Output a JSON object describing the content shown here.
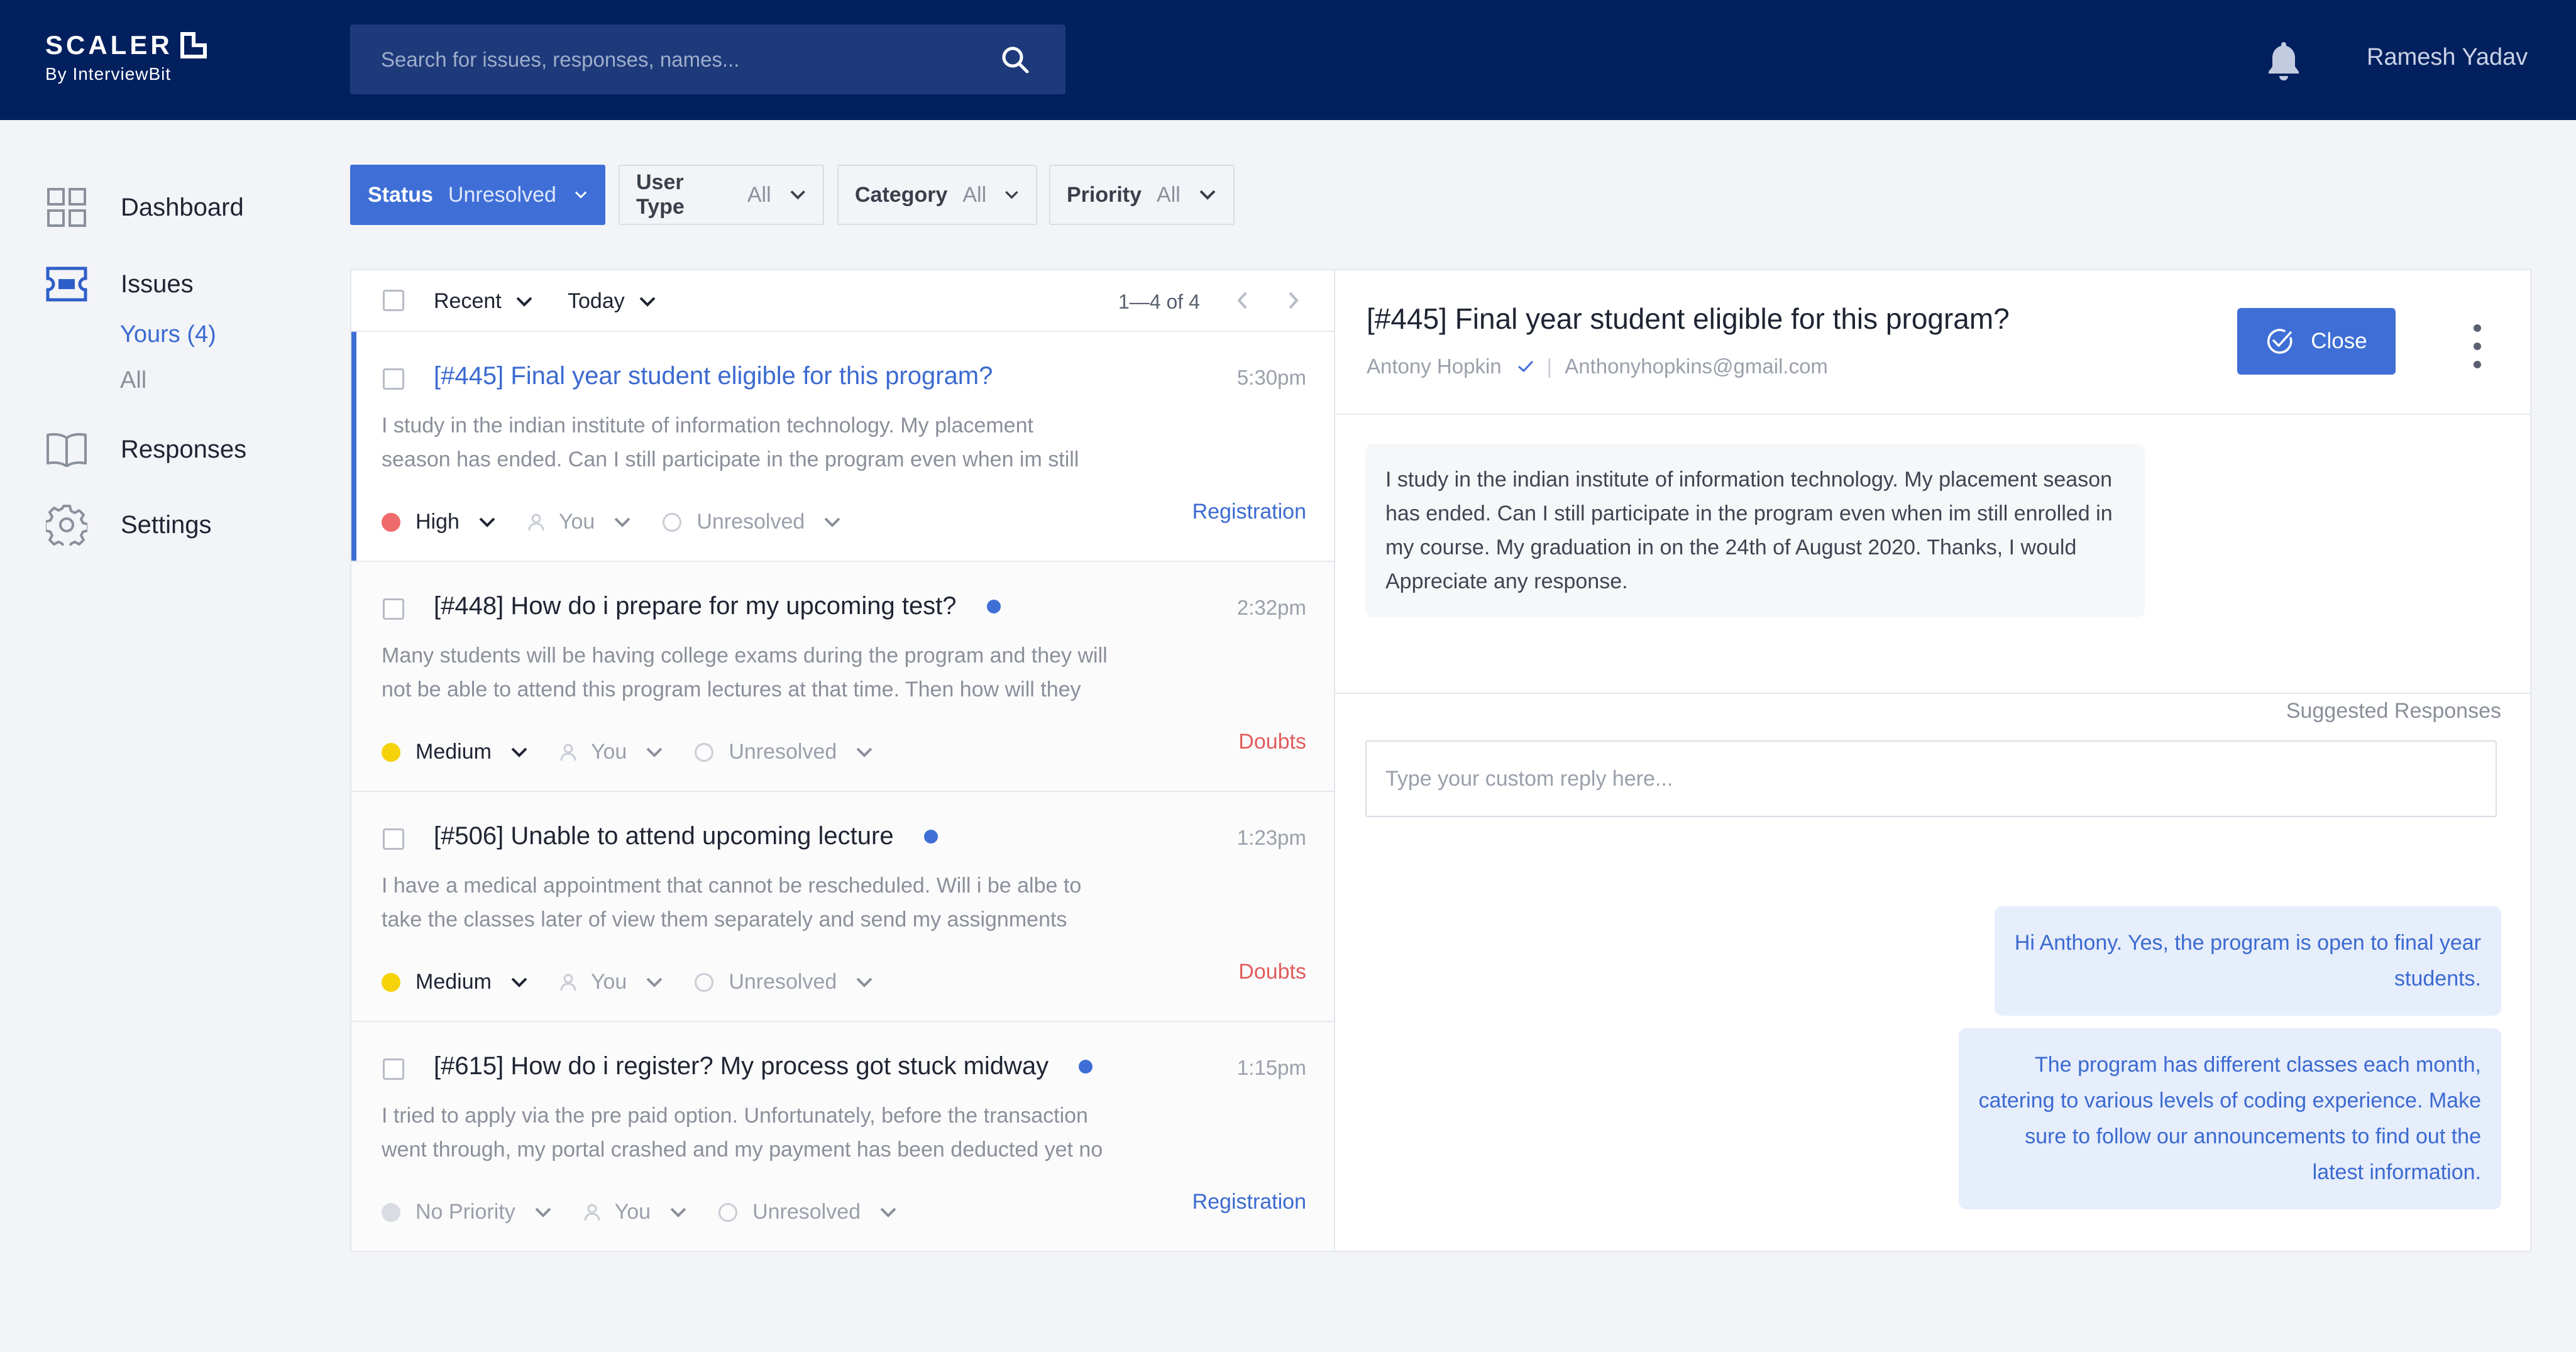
{
  "header": {
    "logo_text": "SCALER",
    "logo_sub": "By InterviewBit",
    "search_placeholder": "Search for issues, responses, names...",
    "user_name": "Ramesh Yadav"
  },
  "sidebar": {
    "dashboard": "Dashboard",
    "issues": "Issues",
    "issues_yours": "Yours (4)",
    "issues_all": "All",
    "responses": "Responses",
    "settings": "Settings"
  },
  "filters": [
    {
      "label": "Status",
      "value": "Unresolved"
    },
    {
      "label": "User Type",
      "value": "All"
    },
    {
      "label": "Category",
      "value": "All"
    },
    {
      "label": "Priority",
      "value": "All"
    }
  ],
  "list": {
    "sort": "Recent",
    "range": "Today",
    "pagination": "1—4 of 4",
    "issues": [
      {
        "title": "[#445] Final year student eligible for this program?",
        "time": "5:30pm",
        "line1": "I study in the indian institute of information technology. My placement",
        "line2": "season has ended. Can I still participate in the program even when im still",
        "priority": "High",
        "assignee": "You",
        "status": "Unresolved",
        "category": "Registration"
      },
      {
        "title": "[#448] How do i prepare for my upcoming test?",
        "time": "2:32pm",
        "line1": "Many students will be having college exams during the program and they will",
        "line2": "not be able to attend this program lectures at that time. Then how will they",
        "priority": "Medium",
        "assignee": "You",
        "status": "Unresolved",
        "category": "Doubts"
      },
      {
        "title": "[#506] Unable to attend upcoming lecture",
        "time": "1:23pm",
        "line1": "I have a medical appointment that cannot be rescheduled. Will i be albe to",
        "line2": "take the classes later of view them separately and send my assignments",
        "priority": "Medium",
        "assignee": "You",
        "status": "Unresolved",
        "category": "Doubts"
      },
      {
        "title": "[#615] How do i register? My process got stuck midway",
        "time": "1:15pm",
        "line1": "I tried to apply via the pre paid option. Unfortunately, before the transaction",
        "line2": "went through, my portal crashed and my payment has been deducted yet no",
        "priority": "No Priority",
        "assignee": "You",
        "status": "Unresolved",
        "category": "Registration"
      }
    ]
  },
  "detail": {
    "title": "[#445] Final year student eligible for this program?",
    "author": "Antony Hopkin",
    "email": "Anthonyhopkins@gmail.com",
    "close_label": "Close",
    "message_lines": [
      "I study in the indian institute of information technology. My placement season",
      "has ended. Can I still participate in the program even when im still enrolled in",
      "my course. My graduation in on the 24th of August 2020. Thanks, I would",
      "Appreciate any response."
    ],
    "reply_placeholder": "Type your custom reply here...",
    "suggested_label": "Suggested Responses",
    "suggestions": [
      {
        "lines": [
          "Hi Anthony. Yes, the program is open to final year",
          "students."
        ]
      },
      {
        "lines": [
          "The program has different classes each month,",
          "catering to various levels of coding experience. Make",
          "sure to follow our announcements to find out the",
          "latest information."
        ]
      }
    ]
  },
  "colors": {
    "topbar": "#03205e",
    "accent": "#3f6fd6",
    "priority_high": "#ef6b6b",
    "priority_medium": "#f5d20a",
    "priority_none": "#d9dce2",
    "category_registration": "#3b6ad0",
    "category_doubts": "#e25c5c"
  },
  "icons": {
    "search": "search-icon",
    "bell": "bell-icon",
    "dashboard": "grid-icon",
    "issues": "ticket-icon",
    "responses": "book-icon",
    "settings": "gear-icon"
  }
}
